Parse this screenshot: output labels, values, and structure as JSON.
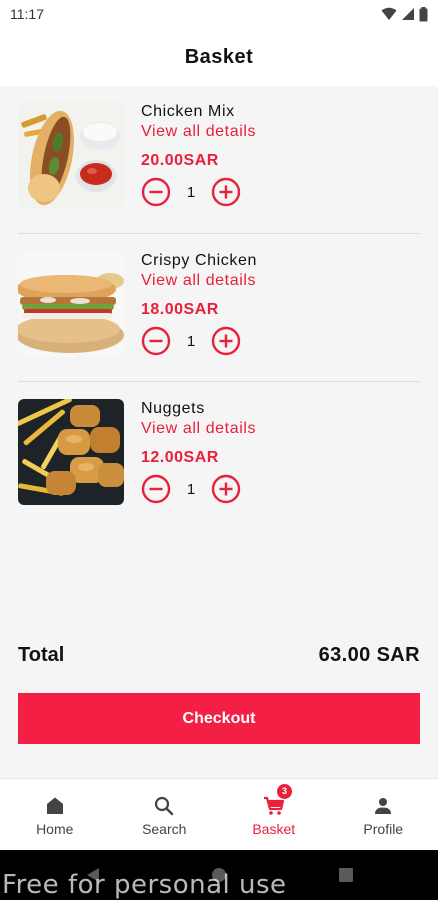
{
  "status_bar": {
    "time": "11:17"
  },
  "app_bar": {
    "title": "Basket"
  },
  "items": [
    {
      "name": "Chicken Mix",
      "details_label": "View all details",
      "price": "20.00SAR",
      "quantity": "1",
      "image": "chicken-mix-sandwich-image"
    },
    {
      "name": "Crispy Chicken",
      "details_label": "View all details",
      "price": "18.00SAR",
      "quantity": "1",
      "image": "crispy-chicken-sandwich-image"
    },
    {
      "name": "Nuggets",
      "details_label": "View all details",
      "price": "12.00SAR",
      "quantity": "1",
      "image": "nuggets-fries-image"
    }
  ],
  "summary": {
    "total_label": "Total",
    "total_value": "63.00 SAR"
  },
  "checkout": {
    "label": "Checkout"
  },
  "bottom_nav": {
    "items": [
      {
        "label": "Home",
        "icon": "home-icon"
      },
      {
        "label": "Search",
        "icon": "search-icon"
      },
      {
        "label": "Basket",
        "icon": "cart-icon",
        "badge": "3",
        "active": true
      },
      {
        "label": "Profile",
        "icon": "person-icon"
      }
    ]
  },
  "watermark": "Free for personal use",
  "colors": {
    "accent": "#e8203c",
    "checkout": "#f41f45",
    "background": "#f5f5f5"
  }
}
